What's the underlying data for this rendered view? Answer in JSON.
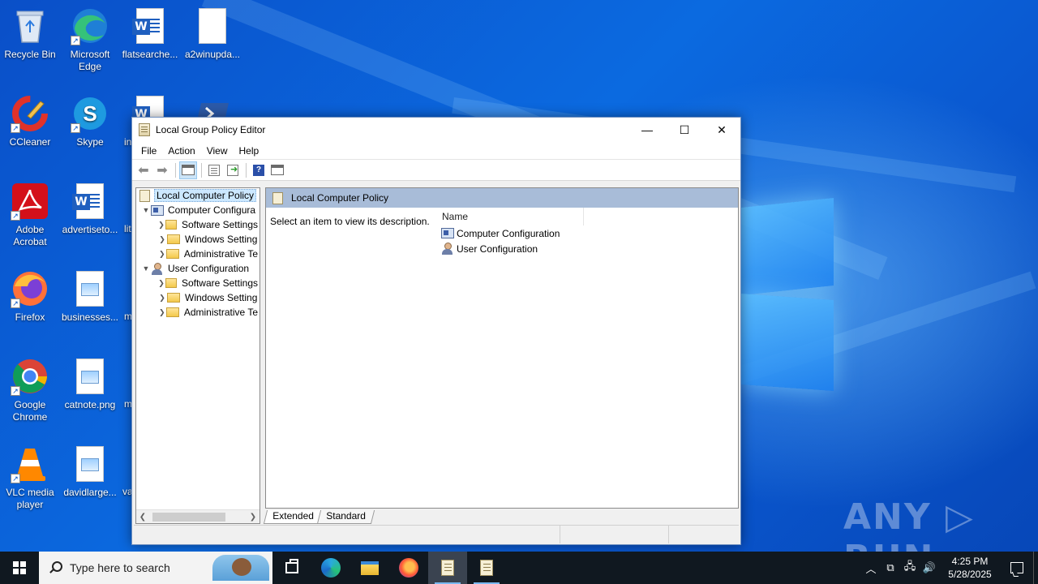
{
  "desktop": {
    "icons": [
      {
        "label": "Recycle Bin",
        "icon": "recycle-bin-icon"
      },
      {
        "label": "Microsoft Edge",
        "icon": "edge-icon"
      },
      {
        "label": "flatsearche...",
        "icon": "word-doc-icon"
      },
      {
        "label": "a2winupda...",
        "icon": "blank-file-icon"
      },
      {
        "label": "CCleaner",
        "icon": "ccleaner-icon"
      },
      {
        "label": "Skype",
        "icon": "skype-icon"
      },
      {
        "label": "in",
        "icon": "word-doc-icon"
      },
      {
        "label": "",
        "icon": "powershell-icon"
      },
      {
        "label": "Adobe Acrobat",
        "icon": "acrobat-icon"
      },
      {
        "label": "advertiseto...",
        "icon": "word-doc-icon"
      },
      {
        "label": "lit",
        "icon": "word-doc-icon"
      },
      {
        "label": "Firefox",
        "icon": "firefox-icon"
      },
      {
        "label": "businesses...",
        "icon": "image-file-icon"
      },
      {
        "label": "m",
        "icon": "image-file-icon"
      },
      {
        "label": "Google Chrome",
        "icon": "chrome-icon"
      },
      {
        "label": "catnote.png",
        "icon": "image-file-icon"
      },
      {
        "label": "m",
        "icon": "image-file-icon"
      },
      {
        "label": "VLC media player",
        "icon": "vlc-icon"
      },
      {
        "label": "davidlarge...",
        "icon": "image-file-icon"
      },
      {
        "label": "va",
        "icon": "image-file-icon"
      }
    ],
    "watermark": "ANY ▷ RUN"
  },
  "window": {
    "title": "Local Group Policy Editor",
    "controls": {
      "minimize": "—",
      "maximize": "☐",
      "close": "✕"
    },
    "menu": [
      "File",
      "Action",
      "View",
      "Help"
    ],
    "toolbar": [
      "back-arrow-icon",
      "forward-arrow-icon",
      "show-hide-tree-icon",
      "properties-list-icon",
      "export-list-icon",
      "help-icon",
      "console-tree-icon"
    ],
    "tree": {
      "root": "Local Computer Policy",
      "computer_config": "Computer Configura",
      "computer_children": [
        "Software Settings",
        "Windows Setting",
        "Administrative Te"
      ],
      "user_config": "User Configuration",
      "user_children": [
        "Software Settings",
        "Windows Setting",
        "Administrative Te"
      ]
    },
    "right_pane": {
      "header": "Local Computer Policy",
      "description": "Select an item to view its description.",
      "column_name": "Name",
      "items": [
        "Computer Configuration",
        "User Configuration"
      ]
    },
    "tabs": [
      "Extended",
      "Standard"
    ]
  },
  "taskbar": {
    "search_placeholder": "Type here to search",
    "time": "4:25 PM",
    "date": "5/28/2025",
    "tray_icons": [
      "chevron-up-icon",
      "meet-now-icon",
      "network-icon",
      "volume-icon"
    ]
  }
}
